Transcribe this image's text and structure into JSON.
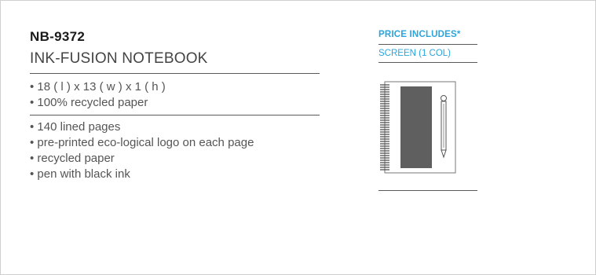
{
  "product": {
    "code": "NB-9372",
    "name": "INK-FUSION NOTEBOOK",
    "specs": [
      "• 18 ( l ) x 13 ( w ) x 1 ( h )",
      "• 100% recycled paper"
    ],
    "features": [
      "• 140 lined pages",
      "• pre-printed eco-logical logo on each page",
      "• recycled paper",
      "• pen with black ink"
    ]
  },
  "pricing": {
    "heading": "PRICE INCLUDES*",
    "items": [
      "SCREEN (1 COL)"
    ]
  },
  "illustration": {
    "icon": "notebook-with-pen-icon"
  },
  "colors": {
    "accent": "#2aa5dc",
    "text": "#4a4a4a",
    "rule": "#5a5a5a"
  }
}
